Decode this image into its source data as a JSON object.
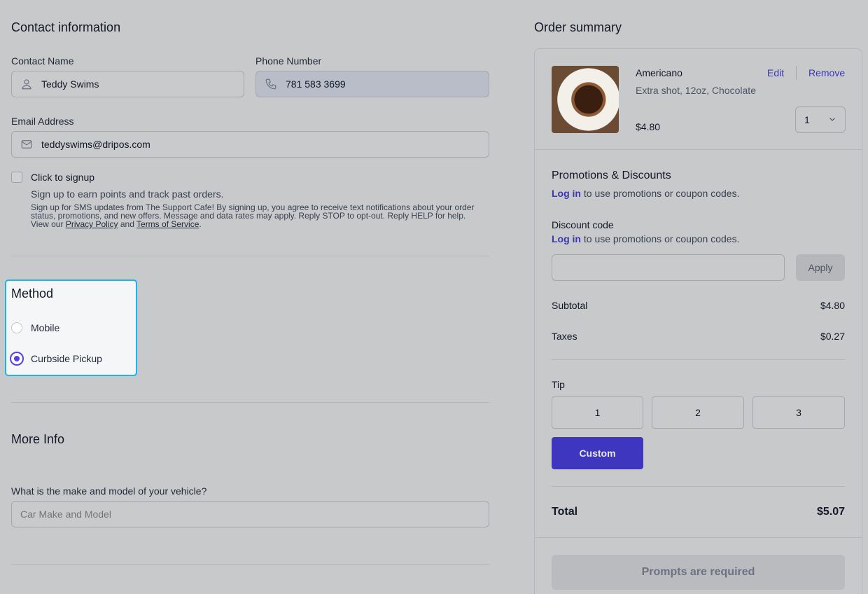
{
  "contact": {
    "heading": "Contact information",
    "name_label": "Contact Name",
    "name_value": "Teddy Swims",
    "phone_label": "Phone Number",
    "phone_value": "781 583 3699",
    "email_label": "Email Address",
    "email_value": "teddyswims@dripos.com",
    "signup_label": "Click to signup",
    "signup_desc": "Sign up to earn points and track past orders.",
    "sms_text": "Sign up for SMS updates from The Support Cafe! By signing up, you agree to receive text notifications about your order status, promotions, and new offers. Message and data rates may apply. Reply STOP to opt-out. Reply HELP for help. View our",
    "privacy_link": "Privacy Policy",
    "and_text": "and",
    "terms_link": "Terms of Service",
    "period": "."
  },
  "method": {
    "heading": "Method",
    "options": [
      {
        "label": "Mobile",
        "selected": false
      },
      {
        "label": "Curbside Pickup",
        "selected": true
      }
    ]
  },
  "more_info": {
    "heading": "More Info",
    "vehicle_label": "What is the make and model of your vehicle?",
    "vehicle_placeholder": "Car Make and Model"
  },
  "order": {
    "heading": "Order summary",
    "item": {
      "name": "Americano",
      "options": "Extra shot, 12oz, Chocolate",
      "price": "$4.80",
      "quantity": "1",
      "edit": "Edit",
      "remove": "Remove"
    },
    "promotions": {
      "heading": "Promotions & Discounts",
      "login_link": "Log in",
      "login_text": "to use promotions or coupon codes."
    },
    "discount": {
      "label": "Discount code",
      "login_link": "Log in",
      "login_text": "to use promotions or coupon codes.",
      "apply": "Apply"
    },
    "subtotal_label": "Subtotal",
    "subtotal_value": "$4.80",
    "taxes_label": "Taxes",
    "taxes_value": "$0.27",
    "tip": {
      "label": "Tip",
      "options": [
        "1",
        "2",
        "3"
      ],
      "custom": "Custom"
    },
    "total_label": "Total",
    "total_value": "$5.07",
    "submit": "Prompts are required"
  },
  "colors": {
    "accent": "#3f36c0",
    "focus_ring": "#22b3e6",
    "background": "#c8c9cb"
  }
}
